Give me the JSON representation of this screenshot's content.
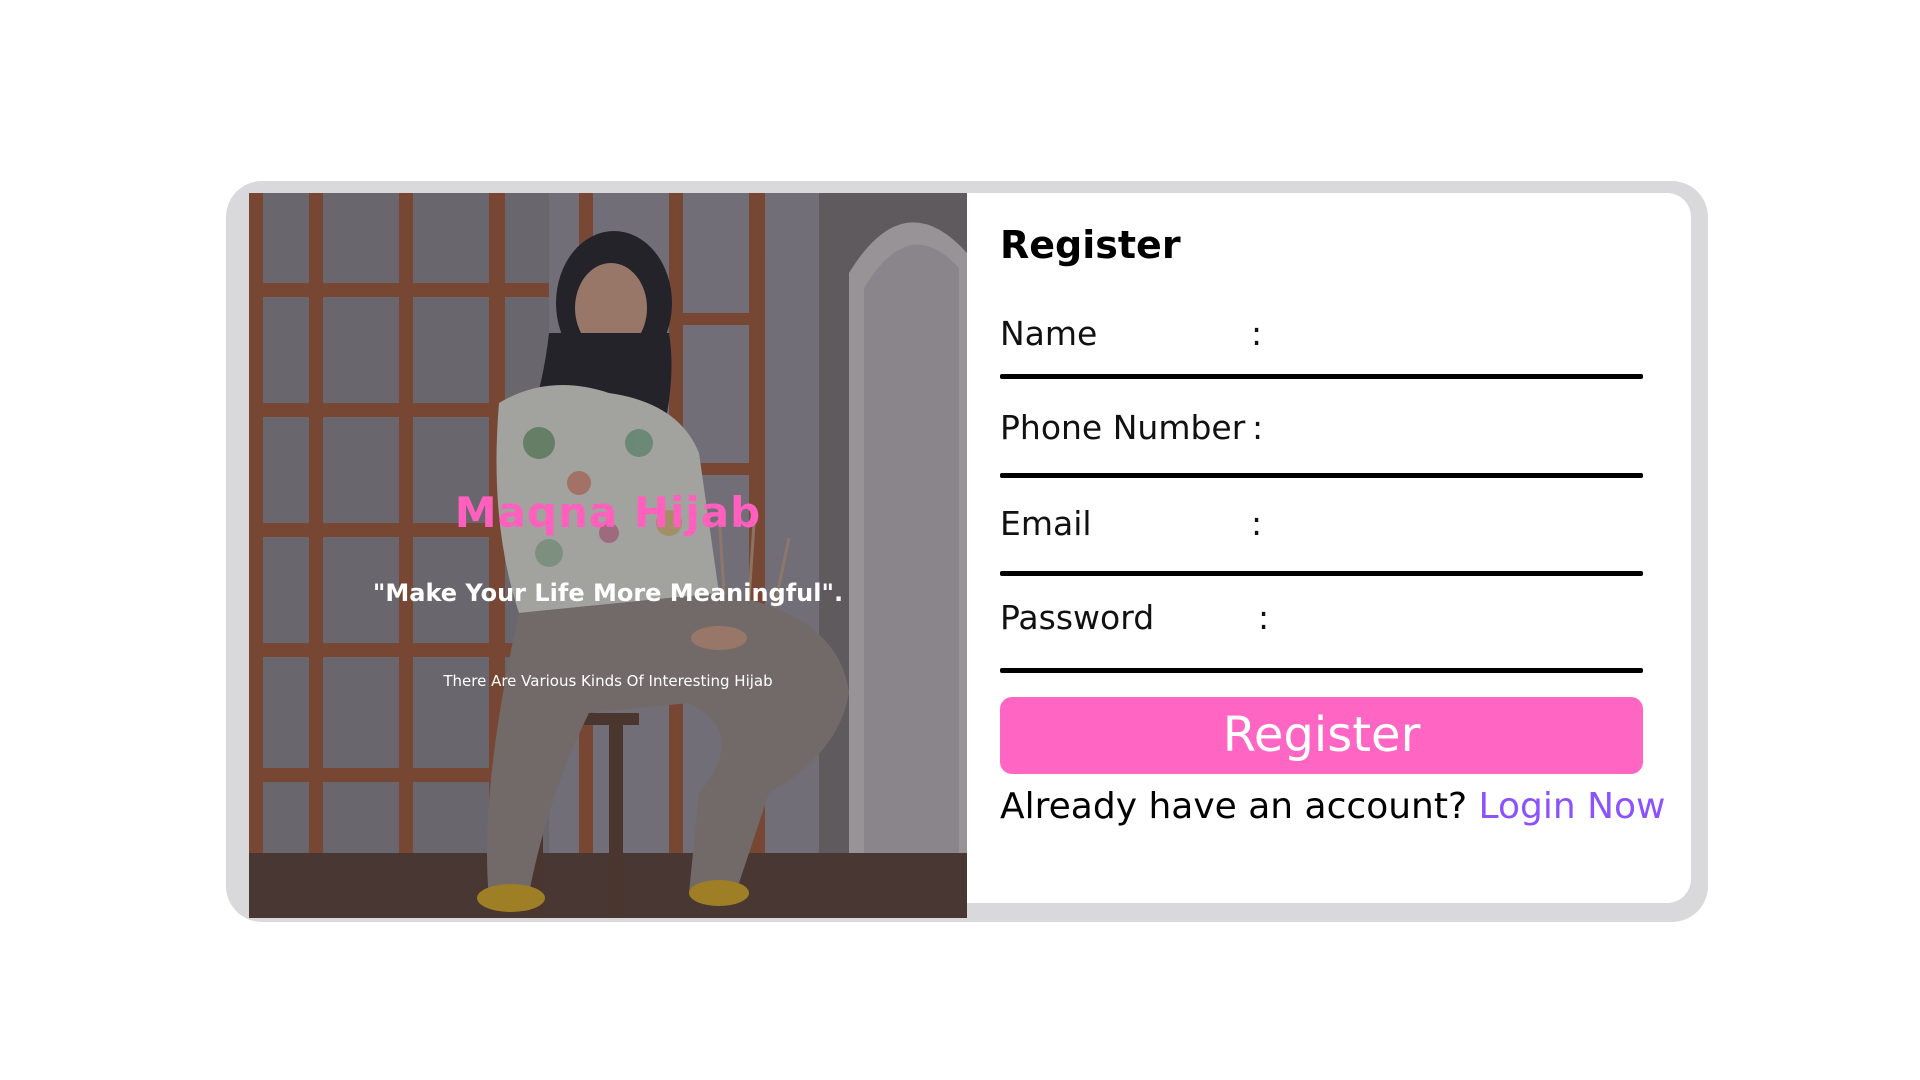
{
  "brand": {
    "name": "Maqna Hijab",
    "quote": "\"Make Your Life More Meaningful\".",
    "tagline": "There Are Various Kinds Of Interesting Hijab"
  },
  "form": {
    "title": "Register",
    "fields": [
      {
        "label": "Name",
        "colon": ":",
        "value": ""
      },
      {
        "label": "Phone Number",
        "colon": ":",
        "value": ""
      },
      {
        "label": "Email",
        "colon": ":",
        "value": ""
      },
      {
        "label": "Password",
        "colon": ":",
        "value": ""
      }
    ],
    "submit_label": "Register",
    "account_prompt": "Already have an account?",
    "login_label": "Login Now"
  },
  "colors": {
    "accent_pink": "#ff66c4",
    "brand_pink": "#ff5fbd",
    "link_purple": "#8c52ff",
    "frame_gray": "#d9d9db"
  }
}
